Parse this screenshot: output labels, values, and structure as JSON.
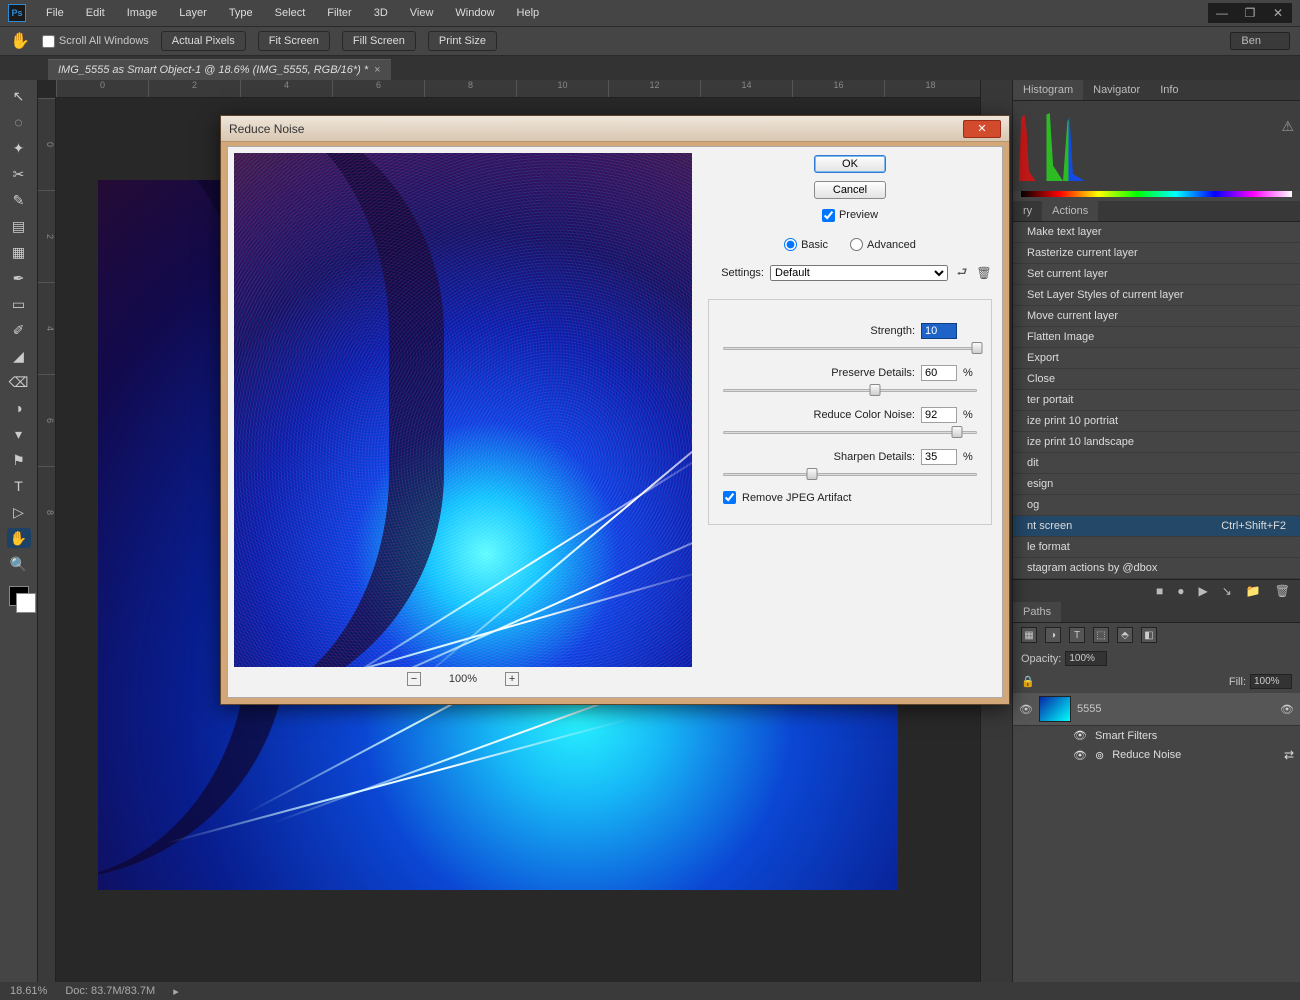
{
  "app": {
    "logo": "Ps"
  },
  "menubar": [
    "File",
    "Edit",
    "Image",
    "Layer",
    "Type",
    "Select",
    "Filter",
    "3D",
    "View",
    "Window",
    "Help"
  ],
  "window_controls": [
    "—",
    "❐",
    "✕"
  ],
  "options_bar": {
    "hand_icon": "✋",
    "scroll_all": "Scroll All Windows",
    "buttons": [
      "Actual Pixels",
      "Fit Screen",
      "Fill Screen",
      "Print Size"
    ],
    "user": "Ben"
  },
  "doc_tab": {
    "title": "IMG_5555 as Smart Object-1 @ 18.6% (IMG_5555, RGB/16*) *",
    "close": "×"
  },
  "ruler_top": [
    "0",
    "2",
    "4",
    "6",
    "8",
    "10",
    "12",
    "14",
    "16",
    "18"
  ],
  "ruler_left": [
    "0",
    "2",
    "4",
    "6",
    "8"
  ],
  "status": {
    "zoom": "18.61%",
    "doc": "Doc: 83.7M/83.7M"
  },
  "panels": {
    "hist_tabs": [
      "Histogram",
      "Navigator",
      "Info"
    ],
    "warn": "⚠",
    "actions_tabs": [
      "ry",
      "Actions"
    ],
    "actions": [
      {
        "label": "Make text layer"
      },
      {
        "label": "Rasterize current layer"
      },
      {
        "label": "Set current layer"
      },
      {
        "label": "Set Layer Styles of current layer"
      },
      {
        "label": "Move current layer"
      },
      {
        "label": "Flatten Image"
      },
      {
        "label": "Export"
      },
      {
        "label": "Close"
      },
      {
        "label": "ter portait"
      },
      {
        "label": "ize print 10 portriat"
      },
      {
        "label": "ize print 10 landscape"
      },
      {
        "label": "dit"
      },
      {
        "label": "esign"
      },
      {
        "label": "og"
      },
      {
        "label": "nt screen",
        "short": "Ctrl+Shift+F2",
        "sel": true
      },
      {
        "label": "le format"
      },
      {
        "label": "stagram actions by @dbox"
      }
    ],
    "act_btns": [
      "■",
      "●",
      "▶",
      "↘",
      "📁",
      "🗑"
    ],
    "layer_tabs": [
      "Paths"
    ],
    "layer_icons": [
      "▦",
      "◑",
      "T",
      "⬚",
      "⬘",
      "◧"
    ],
    "opacity_label": "Opacity:",
    "opacity_val": "100%",
    "fill_label": "Fill:",
    "fill_val": "100%",
    "lock_icon": "🔒",
    "layer_name": "5555",
    "smart_filters": "Smart Filters",
    "filter_reduce": "Reduce Noise",
    "eye": "👁",
    "filter_ic": "⊚",
    "filter_arrows": "⇄"
  },
  "dialog": {
    "title": "Reduce Noise",
    "ok": "OK",
    "cancel": "Cancel",
    "preview": "Preview",
    "basic": "Basic",
    "advanced": "Advanced",
    "settings_label": "Settings:",
    "settings_value": "Default",
    "save_ic": "⮐",
    "trash_ic": "🗑",
    "sliders": {
      "strength": {
        "label": "Strength:",
        "value": "10",
        "pos": 100,
        "pct": ""
      },
      "preserve": {
        "label": "Preserve Details:",
        "value": "60",
        "pos": 60,
        "pct": "%"
      },
      "colornoise": {
        "label": "Reduce Color Noise:",
        "value": "92",
        "pos": 92,
        "pct": "%"
      },
      "sharpen": {
        "label": "Sharpen Details:",
        "value": "35",
        "pos": 35,
        "pct": "%"
      }
    },
    "jpeg": "Remove JPEG Artifact",
    "zoom_minus": "−",
    "zoom_val": "100%",
    "zoom_plus": "+"
  },
  "tools": [
    "↖",
    "◌",
    "✦",
    "✂",
    "✎",
    "▤",
    "▦",
    "✒",
    "▭",
    "✐",
    "◢",
    "⌫",
    "◑",
    "▾",
    "⚑",
    "T",
    "▷",
    "✋",
    "🔍"
  ]
}
